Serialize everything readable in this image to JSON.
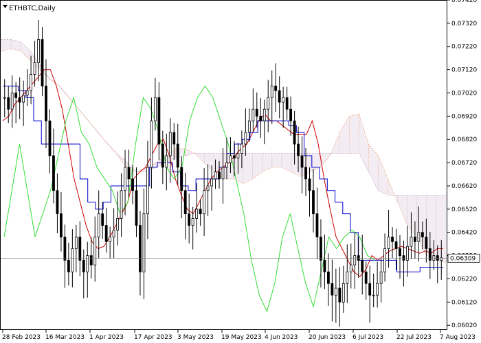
{
  "chart": {
    "symbol_label": "ETHBTC,Daily",
    "menu_icon": "triangle-down-icon",
    "current_price_label": "0.06309"
  },
  "colors": {
    "background": "#ffffff",
    "candle": "#000000",
    "tenkan": "#cc0000",
    "kijun": "#0000cc",
    "chikou": "#33dd33",
    "kumo_span_a": "#ee9966",
    "kumo_span_b": "#bb99bb",
    "price_line": "#777777"
  },
  "chart_data": {
    "type": "candlestick",
    "indicator": "Ichimoku Kinko Hyo",
    "yticks": [
      "0.07420",
      "0.07320",
      "0.07220",
      "0.07120",
      "0.07020",
      "0.06920",
      "0.06820",
      "0.06720",
      "0.06620",
      "0.06520",
      "0.06420",
      "0.06320",
      "0.06220",
      "0.06120",
      "0.06020"
    ],
    "yrange": [
      0.06,
      0.0742
    ],
    "xticks": [
      "28 Feb 2023",
      "16 Mar 2023",
      "1 Apr 2023",
      "17 Apr 2023",
      "3 May 2023",
      "19 May 2023",
      "4 Jun 2023",
      "20 Jun 2023",
      "6 Jul 2023",
      "22 Jul 2023",
      "7 Aug 2023"
    ],
    "current_price": 0.06309,
    "close_series": [
      0.07,
      0.0695,
      0.0702,
      0.07,
      0.0698,
      0.0701,
      0.0703,
      0.071,
      0.0715,
      0.0725,
      0.0705,
      0.069,
      0.0675,
      0.066,
      0.065,
      0.064,
      0.063,
      0.0625,
      0.0635,
      0.064,
      0.063,
      0.0625,
      0.0632,
      0.0628,
      0.064,
      0.065,
      0.0645,
      0.0638,
      0.064,
      0.0643,
      0.0648,
      0.066,
      0.067,
      0.0665,
      0.066,
      0.0645,
      0.0625,
      0.065,
      0.067,
      0.069,
      0.07,
      0.068,
      0.067,
      0.0675,
      0.0685,
      0.068,
      0.067,
      0.066,
      0.065,
      0.0645,
      0.0648,
      0.0652,
      0.065,
      0.066,
      0.0662,
      0.0665,
      0.0668,
      0.0665,
      0.067,
      0.0672,
      0.0675,
      0.0674,
      0.0676,
      0.068,
      0.0685,
      0.069,
      0.0695,
      0.0692,
      0.069,
      0.0695,
      0.07,
      0.0705,
      0.0703,
      0.0698,
      0.07,
      0.0695,
      0.069,
      0.068,
      0.0675,
      0.067,
      0.0665,
      0.066,
      0.065,
      0.064,
      0.063,
      0.0625,
      0.062,
      0.0615,
      0.0618,
      0.0612,
      0.062,
      0.0625,
      0.0628,
      0.0632,
      0.063,
      0.0625,
      0.062,
      0.0615,
      0.0615,
      0.062,
      0.0625,
      0.0635,
      0.064,
      0.0638,
      0.0635,
      0.0632,
      0.063,
      0.0636,
      0.064,
      0.0638,
      0.0642,
      0.064,
      0.0635,
      0.063,
      0.0632,
      0.063,
      0.0631
    ],
    "tenkan_series": [
      0.069,
      0.0692,
      0.0697,
      0.07,
      0.0703,
      0.0706,
      0.0709,
      0.0712,
      0.0712,
      0.0705,
      0.0695,
      0.068,
      0.0665,
      0.0655,
      0.0645,
      0.0638,
      0.0635,
      0.0636,
      0.064,
      0.0645,
      0.065,
      0.0655,
      0.0665,
      0.0668,
      0.067,
      0.0675,
      0.068,
      0.0682,
      0.0675,
      0.0665,
      0.0658,
      0.0652,
      0.065,
      0.0655,
      0.066,
      0.0665,
      0.0668,
      0.067,
      0.0672,
      0.0675,
      0.0678,
      0.068,
      0.0685,
      0.069,
      0.0693,
      0.069,
      0.069,
      0.0688,
      0.0686,
      0.0684,
      0.0684,
      0.0684,
      0.069,
      0.068,
      0.0665,
      0.0652,
      0.064,
      0.0635,
      0.063,
      0.0625,
      0.0623,
      0.0626,
      0.0632,
      0.063,
      0.0632,
      0.0634,
      0.0635,
      0.0636,
      0.0635,
      0.0634,
      0.0633,
      0.0634,
      0.0633,
      0.0635,
      0.0635
    ],
    "kijun_series": [
      0.0705,
      0.0705,
      0.0703,
      0.07,
      0.069,
      0.068,
      0.068,
      0.068,
      0.068,
      0.068,
      0.0665,
      0.0655,
      0.0652,
      0.0655,
      0.0662,
      0.0662,
      0.0662,
      0.0662,
      0.0662,
      0.067,
      0.0672,
      0.0672,
      0.0668,
      0.0662,
      0.066,
      0.0665,
      0.0665,
      0.0665,
      0.067,
      0.0676,
      0.068,
      0.0682,
      0.0685,
      0.069,
      0.069,
      0.069,
      0.069,
      0.0688,
      0.0685,
      0.0675,
      0.067,
      0.0665,
      0.066,
      0.0655,
      0.065,
      0.0642,
      0.063,
      0.063,
      0.063,
      0.063,
      0.063,
      0.0625,
      0.0625,
      0.0625,
      0.0627,
      0.0627,
      0.0627,
      0.0627
    ],
    "chikou_series": [
      0.064,
      0.066,
      0.068,
      0.066,
      0.064,
      0.065,
      0.066,
      0.0675,
      0.069,
      0.07,
      0.0685,
      0.068,
      0.067,
      0.0665,
      0.066,
      0.065,
      0.0655,
      0.068,
      0.07,
      0.0695,
      0.0685,
      0.067,
      0.0665,
      0.067,
      0.069,
      0.07,
      0.0705,
      0.07,
      0.069,
      0.068,
      0.0665,
      0.065,
      0.063,
      0.0615,
      0.0608,
      0.062,
      0.064,
      0.065,
      0.0635,
      0.062,
      0.061,
      0.0625,
      0.064,
      0.0635,
      0.064,
      0.0643,
      0.064,
      0.0632,
      0.063
    ],
    "span_a_series": [
      0.072,
      0.0721,
      0.072,
      0.0716,
      0.0712,
      0.0708,
      0.0705,
      0.07,
      0.0695,
      0.069,
      0.0685,
      0.068,
      0.0675,
      0.067,
      0.0668,
      0.067,
      0.0672,
      0.0675,
      0.0678,
      0.0678,
      0.0676,
      0.0672,
      0.0668,
      0.0665,
      0.0665,
      0.0663,
      0.0665,
      0.0668,
      0.067,
      0.067,
      0.0668,
      0.0666,
      0.0668,
      0.067,
      0.0675,
      0.0685,
      0.0692,
      0.0693,
      0.068,
      0.0675,
      0.0665,
      0.0655,
      0.0645,
      0.064,
      0.0632,
      0.063,
      0.0629
    ],
    "span_b_series": [
      0.0725,
      0.0725,
      0.0724,
      0.072,
      0.0714,
      0.0708,
      0.0705,
      0.07,
      0.0695,
      0.069,
      0.0685,
      0.068,
      0.0676,
      0.0672,
      0.0668,
      0.0668,
      0.067,
      0.0672,
      0.0674,
      0.0675,
      0.0676,
      0.0676,
      0.0676,
      0.0676,
      0.0676,
      0.0676,
      0.0676,
      0.0676,
      0.0676,
      0.0676,
      0.0676,
      0.0676,
      0.0676,
      0.0676,
      0.0676,
      0.0676,
      0.0676,
      0.0676,
      0.0668,
      0.066,
      0.0658,
      0.0658,
      0.0658,
      0.0658,
      0.0658,
      0.0658,
      0.0658
    ]
  }
}
